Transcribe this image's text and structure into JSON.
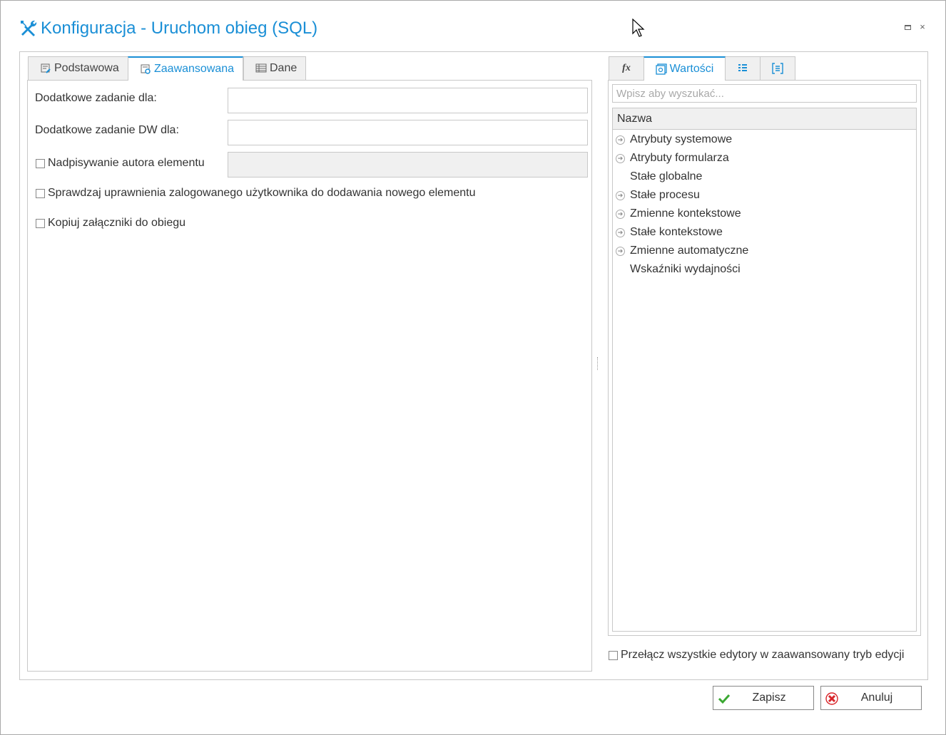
{
  "window": {
    "title": "Konfiguracja - Uruchom obieg (SQL)",
    "title_icon": "tools-icon",
    "maximize_icon": "maximize-icon",
    "close_icon": "close-icon",
    "close_glyph": "×"
  },
  "left_tabs": [
    {
      "label": "Podstawowa",
      "icon": "form-icon"
    },
    {
      "label": "Zaawansowana",
      "icon": "form-settings-icon"
    },
    {
      "label": "Dane",
      "icon": "table-icon"
    }
  ],
  "advanced": {
    "extra_task_label": "Dodatkowe zadanie dla:",
    "extra_task_value": "",
    "extra_task_dw_label": "Dodatkowe zadanie DW dla:",
    "extra_task_dw_value": "",
    "override_author_label": "Nadpisywanie autora elementu",
    "override_author_value": "",
    "check_permissions_label": "Sprawdzaj uprawnienia zalogowanego użytkownika do dodawania nowego elementu",
    "copy_attachments_label": "Kopiuj załączniki do obiegu"
  },
  "right_tabs": [
    {
      "label": "",
      "icon": "function-icon",
      "glyph": "fx"
    },
    {
      "label": "Wartości",
      "icon": "values-icon"
    },
    {
      "label": "",
      "icon": "list-icon"
    },
    {
      "label": "",
      "icon": "form-fields-icon"
    }
  ],
  "values": {
    "search_placeholder": "Wpisz aby wyszukać...",
    "column_header": "Nazwa",
    "items": [
      {
        "label": "Atrybuty systemowe",
        "expandable": true
      },
      {
        "label": "Atrybuty formularza",
        "expandable": true
      },
      {
        "label": "Stałe globalne",
        "expandable": false
      },
      {
        "label": "Stałe procesu",
        "expandable": true
      },
      {
        "label": "Zmienne kontekstowe",
        "expandable": true
      },
      {
        "label": "Stałe kontekstowe",
        "expandable": true
      },
      {
        "label": "Zmienne automatyczne",
        "expandable": true
      },
      {
        "label": "Wskaźniki wydajności",
        "expandable": false
      }
    ]
  },
  "advanced_mode_label": "Przełącz wszystkie edytory w zaawansowany tryb edycji",
  "buttons": {
    "save_label": "Zapisz",
    "cancel_label": "Anuluj"
  },
  "colors": {
    "accent": "#1a8fd6",
    "save_check": "#3aa832",
    "cancel_x": "#d9252a"
  }
}
